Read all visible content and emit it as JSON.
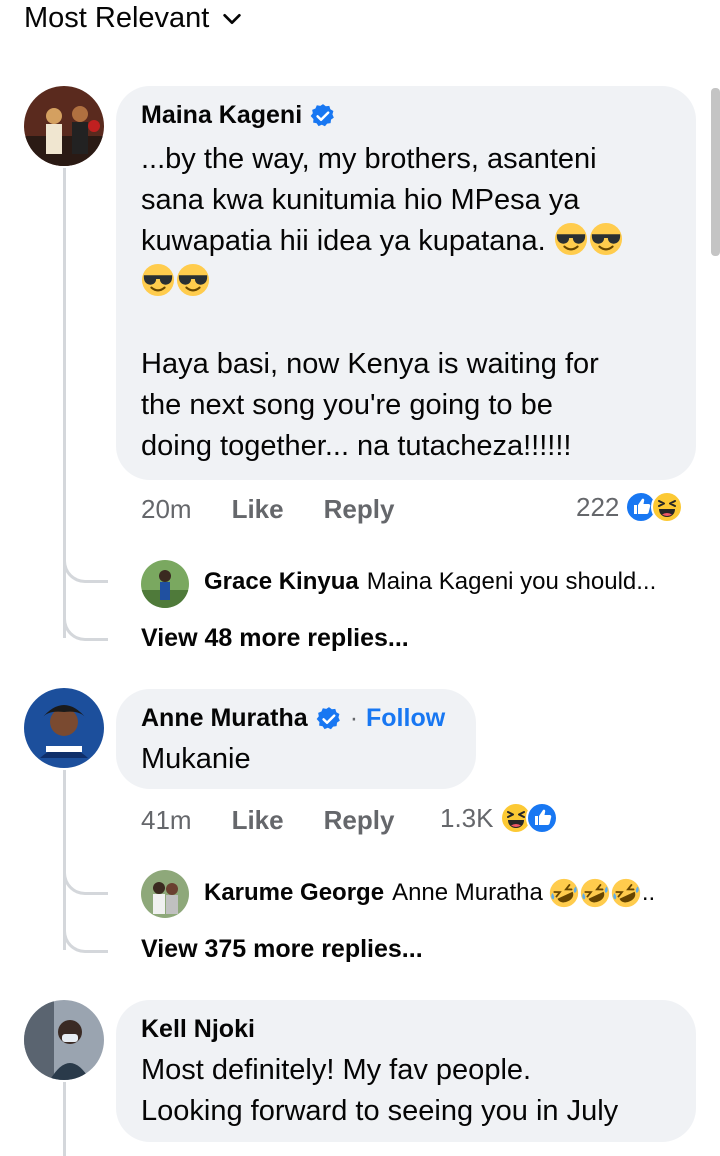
{
  "sort_label": "Most Relevant",
  "colors": {
    "accent": "#1877f2",
    "bubble": "#f0f2f5",
    "meta": "#65676b"
  },
  "comments": [
    {
      "author": "Maina Kageni",
      "text_lines": [
        "...by the way, my brothers, asanteni",
        "sana kwa kunitumia hio MPesa ya",
        "kuwapatia hii idea ya kupatana."
      ],
      "text_lines_b": [
        "Haya basi, now Kenya is waiting for",
        "the next song you're going to be",
        "doing together... na tutacheza!!!!!!"
      ],
      "time": "20m",
      "like": "Like",
      "reply": "Reply",
      "reaction_count": "222",
      "reply_preview": {
        "author": "Grace Kinyua",
        "text": "Maina Kageni you should..."
      },
      "view_more": "View 48 more replies..."
    },
    {
      "author": "Anne Muratha",
      "follow": "Follow",
      "text": "Mukanie",
      "time": "41m",
      "like": "Like",
      "reply": "Reply",
      "reaction_count": "1.3K",
      "reply_preview": {
        "author": "Karume George",
        "text": "Anne Muratha"
      },
      "view_more": "View 375 more replies..."
    },
    {
      "author": "Kell Njoki",
      "text_lines": [
        "Most definitely! My fav people.",
        "Looking forward to seeing you in July"
      ]
    }
  ]
}
